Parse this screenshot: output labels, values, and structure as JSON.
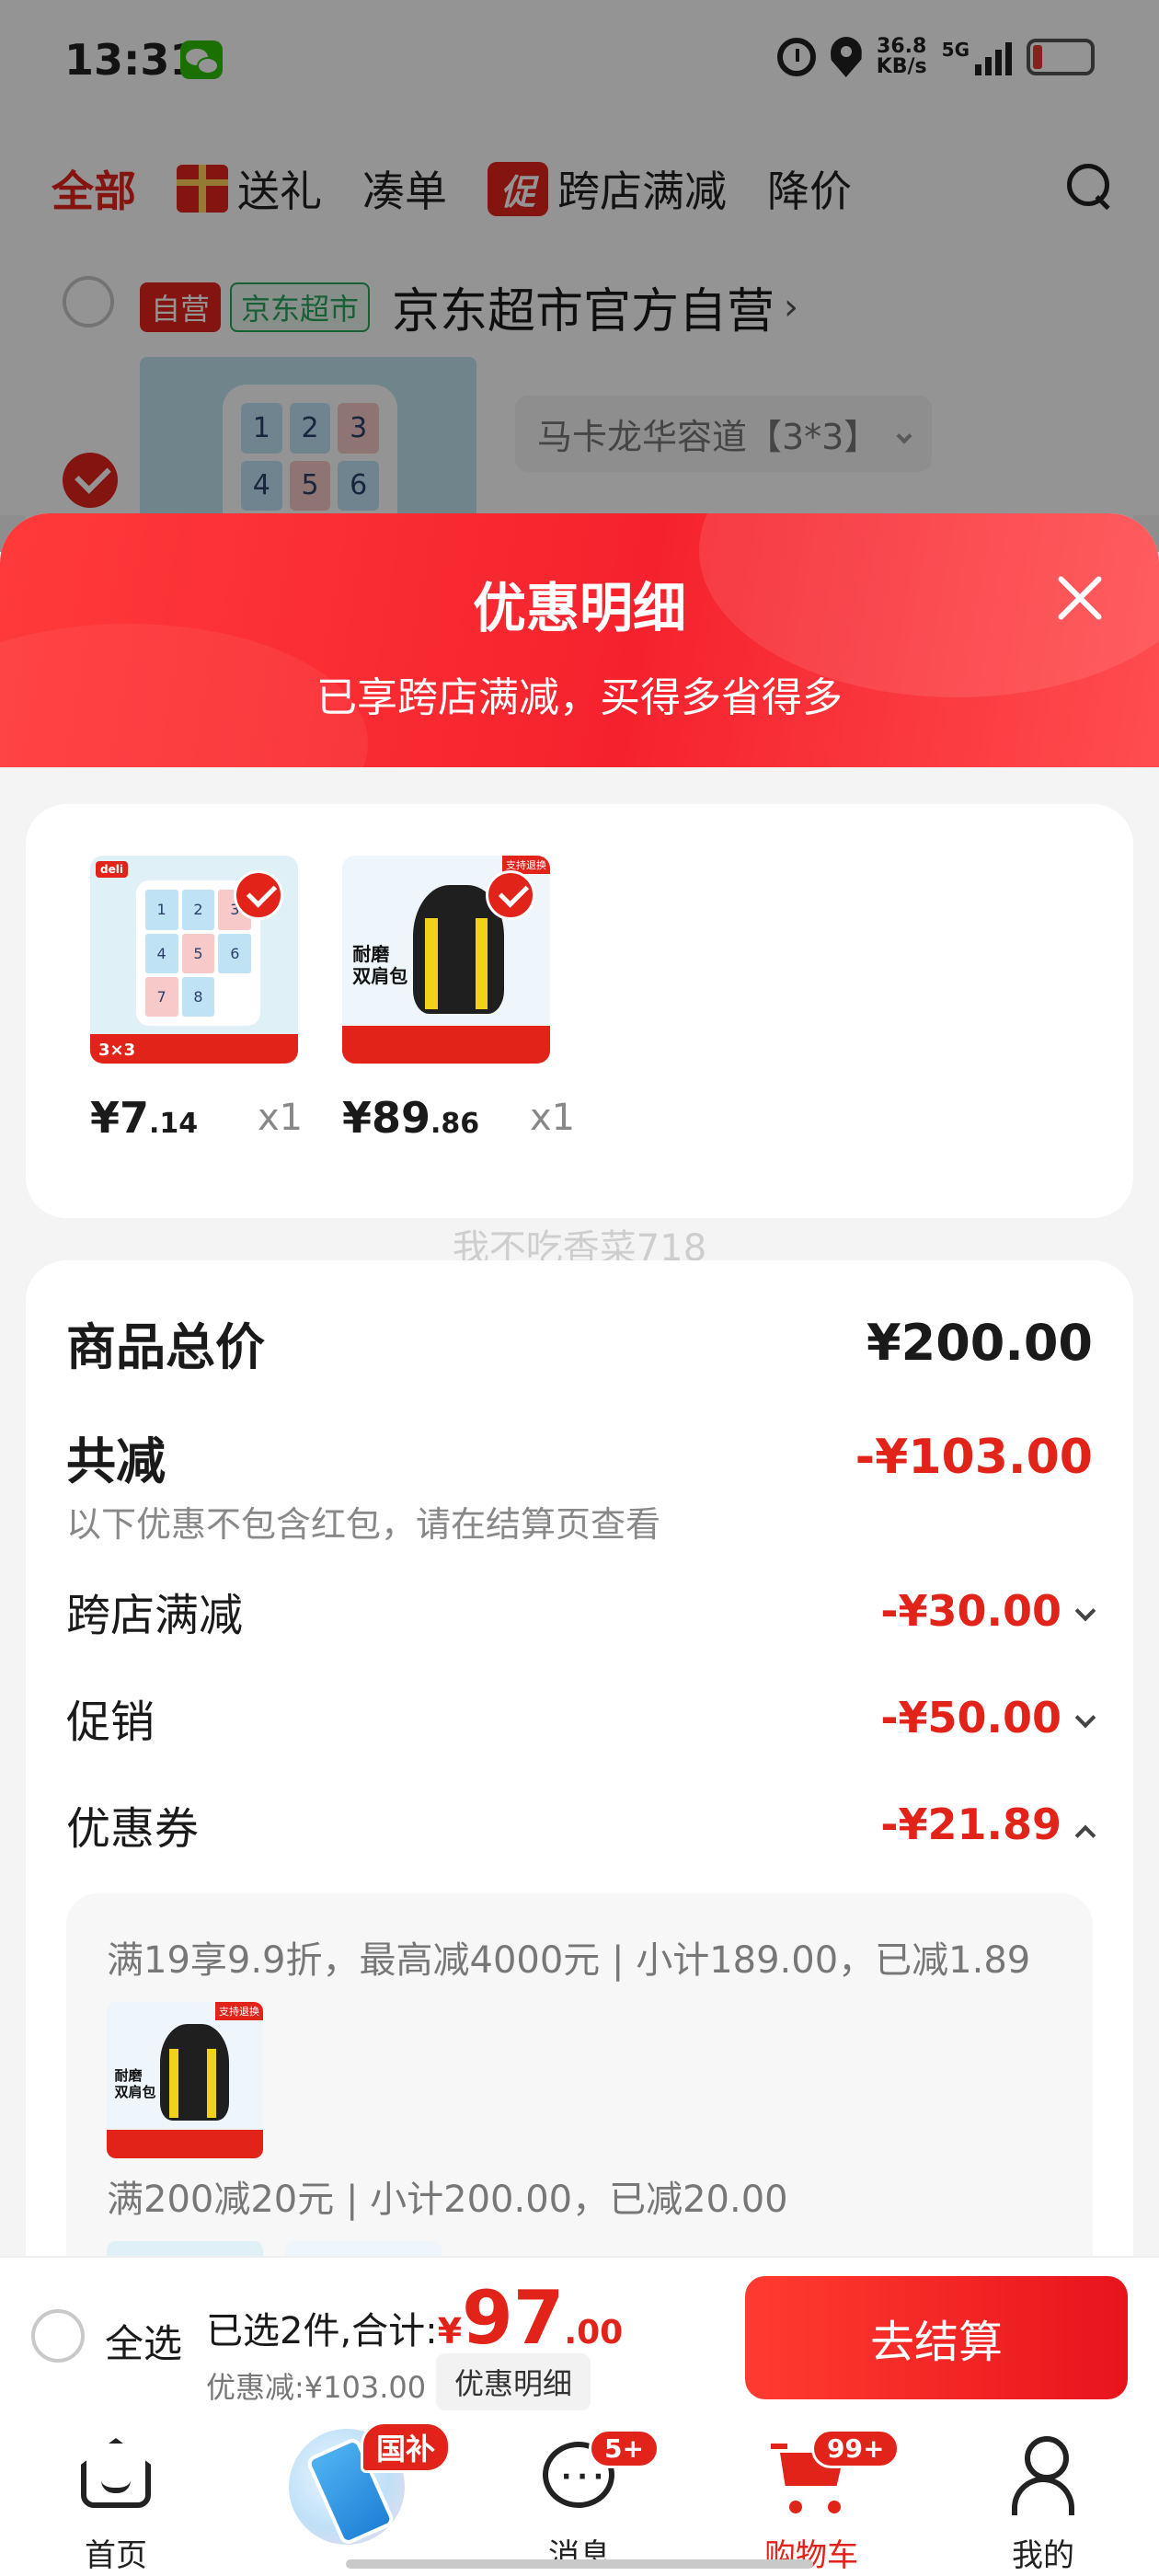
{
  "status_bar": {
    "time": "13:31",
    "net_speed_value": "36.8",
    "net_speed_unit": "KB/s",
    "network": "5G",
    "icons": [
      "wechat-icon",
      "alarm-icon",
      "location-icon",
      "signal-icon",
      "battery-icon"
    ]
  },
  "top_tabs": [
    {
      "label": "全部",
      "active": true
    },
    {
      "label": "送礼",
      "icon": "gift-icon"
    },
    {
      "label": "凑单"
    },
    {
      "label": "跨店满减",
      "badge": "促"
    },
    {
      "label": "降价"
    }
  ],
  "store": {
    "tag_self": "自营",
    "tag_market": "京东超市",
    "name": "京东超市官方自营",
    "arrow": "›",
    "variant": "马卡龙华容道【3*3】",
    "puzzle_numbers": [
      "1",
      "2",
      "3",
      "4",
      "5",
      "6",
      "7",
      "8"
    ]
  },
  "modal": {
    "title": "优惠明细",
    "subtitle": "已享跨店满减，买得多省得多",
    "products": [
      {
        "price_int": "¥7",
        "price_dec": ".14",
        "qty": "x1",
        "image": "puzzle"
      },
      {
        "price_int": "¥89",
        "price_dec": ".86",
        "qty": "x1",
        "image": "backpack"
      }
    ],
    "product_art": {
      "puzzle_logo": "deli",
      "puzzle_size": "3×3",
      "backpack_tag": "支持退换",
      "backpack_text_1": "耐磨",
      "backpack_text_2": "双肩包"
    },
    "watermark": "我不吃香菜718",
    "summary": {
      "total_label": "商品总价",
      "total_value": "¥200.00",
      "reduce_label": "共减",
      "reduce_value": "-¥103.00",
      "note": "以下优惠不包含红包，请在结算页查看",
      "items": [
        {
          "label": "跨店满减",
          "value": "-¥30.00",
          "expanded": false
        },
        {
          "label": "促销",
          "value": "-¥50.00",
          "expanded": false
        },
        {
          "label": "优惠券",
          "value": "-¥21.89",
          "expanded": true
        }
      ]
    },
    "coupons": [
      {
        "text": "满19享9.9折，最高减4000元 | 小计189.00，已减1.89"
      },
      {
        "text": "满200减20元 | 小计200.00，已减20.00"
      }
    ]
  },
  "checkout": {
    "select_all": "全选",
    "selected_text": "已选2件,合计:",
    "currency": "¥",
    "total_int": "97",
    "total_dec": ".00",
    "discount_text": "优惠减:¥103.00",
    "detail_button": "优惠明细",
    "checkout_button": "去结算"
  },
  "bottom_nav": [
    {
      "label": "首页",
      "icon": "home-icon"
    },
    {
      "label": "",
      "icon": "gov-subsidy-icon",
      "badge": "国补"
    },
    {
      "label": "消息",
      "icon": "message-icon",
      "badge": "5+"
    },
    {
      "label": "购物车",
      "icon": "cart-icon",
      "badge": "99+",
      "active": true
    },
    {
      "label": "我的",
      "icon": "user-icon"
    }
  ],
  "colors": {
    "accent": "#e2231a",
    "header_gradient_start": "#ff3a3a",
    "header_gradient_end": "#ff4d4f",
    "market_green": "#26a65b"
  }
}
